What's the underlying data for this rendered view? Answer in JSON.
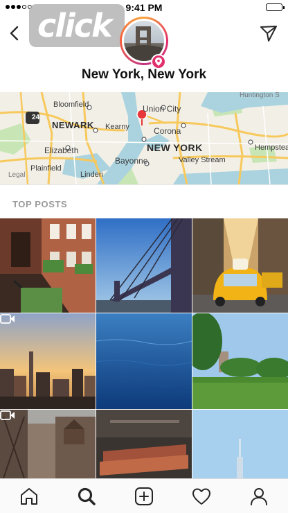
{
  "status_bar": {
    "time": "9:41 PM",
    "signal_dots_filled": 3,
    "signal_dots_total": 5
  },
  "watermark": {
    "text": "click"
  },
  "header": {
    "place_name": "New York, New York",
    "back_icon": "chevron-left-icon",
    "direct_icon": "paper-plane-icon",
    "badge_icon": "location-pin-icon"
  },
  "map": {
    "labels": [
      "Bloomfield",
      "NEWARK",
      "Kearny",
      "Union City",
      "Corona",
      "NEW YORK",
      "Elizabeth",
      "Bayonne",
      "Valley Stream",
      "Hempstead",
      "Plainfield",
      "Linden",
      "Legal",
      "Huntington S"
    ],
    "route_shield": "24",
    "colors": {
      "water": "#aad3df",
      "land": "#f2efe6",
      "park": "#c8e6b5",
      "highway": "#f7c95c",
      "marker": "#e8373a"
    }
  },
  "top_posts": {
    "title": "TOP POSTS",
    "items": [
      {
        "subject": "brownstone-building"
      },
      {
        "subject": "brooklyn-bridge"
      },
      {
        "subject": "yellow-taxi"
      },
      {
        "subject": "skyline-sunset",
        "is_video": true
      },
      {
        "subject": "ocean-water"
      },
      {
        "subject": "central-park"
      },
      {
        "subject": "water-towers",
        "is_video": true
      },
      {
        "subject": "interior-seats"
      },
      {
        "subject": "empire-state-sky"
      }
    ]
  },
  "tab_bar": {
    "items": [
      {
        "name": "home",
        "icon": "home-icon"
      },
      {
        "name": "search",
        "icon": "search-icon",
        "active": true
      },
      {
        "name": "new-post",
        "icon": "plus-square-icon"
      },
      {
        "name": "activity",
        "icon": "heart-icon"
      },
      {
        "name": "profile",
        "icon": "profile-icon"
      }
    ]
  }
}
